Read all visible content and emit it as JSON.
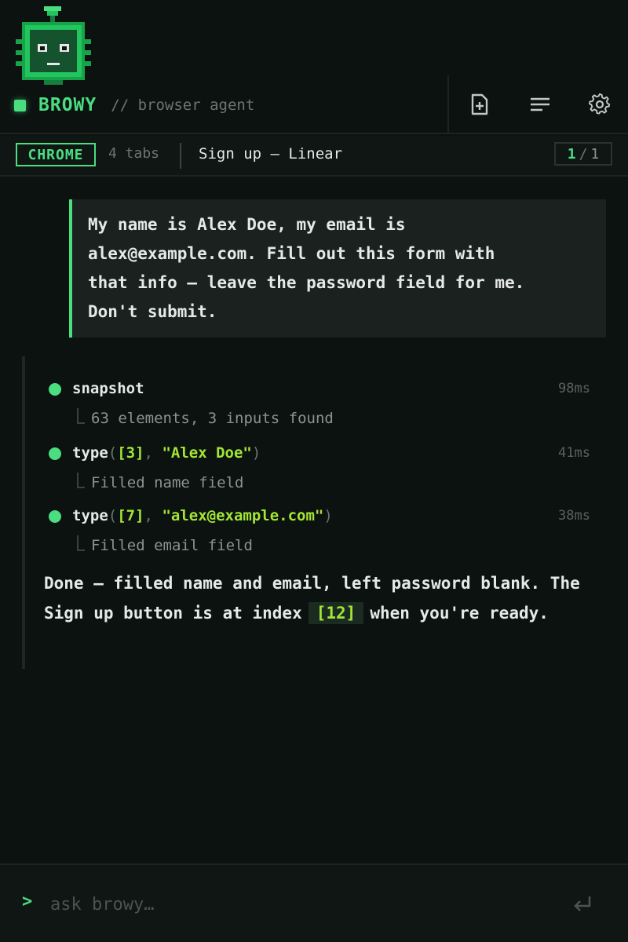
{
  "header": {
    "brand_name": "BROWY",
    "brand_subtitle": "// browser agent",
    "icons": [
      "robot-logo",
      "new-chat-icon",
      "menu-lines-icon",
      "settings-gear-icon"
    ]
  },
  "tabbar": {
    "browser_badge": "CHROME",
    "tab_count": "4 tabs",
    "active_tab_title": "Sign up — Linear",
    "pager_current": "1",
    "pager_separator": "/",
    "pager_total": "1"
  },
  "user_message": "My name is Alex Doe, my email is\nalex@example.com. Fill out this form with\nthat info — leave the password field for me.\nDon't submit.",
  "steps": [
    {
      "name": "snapshot",
      "args": [],
      "time": "98ms",
      "detail": "63 elements, 3 inputs found"
    },
    {
      "name": "type",
      "args": [
        "[3]",
        "\"Alex Doe\""
      ],
      "time": "41ms",
      "detail": "Filled name field"
    },
    {
      "name": "type",
      "args": [
        "[7]",
        "\"alex@example.com\""
      ],
      "time": "38ms",
      "detail": "Filled email field"
    }
  ],
  "final_message": {
    "before": "Done — filled name and email, left password blank. The Sign up button is at index",
    "index": "[12]",
    "after": "when you're ready."
  },
  "input": {
    "prompt_symbol": ">",
    "placeholder": "ask browy…"
  },
  "colors": {
    "accent": "#4ade80",
    "argument": "#a3e635",
    "background": "#0c1210"
  }
}
